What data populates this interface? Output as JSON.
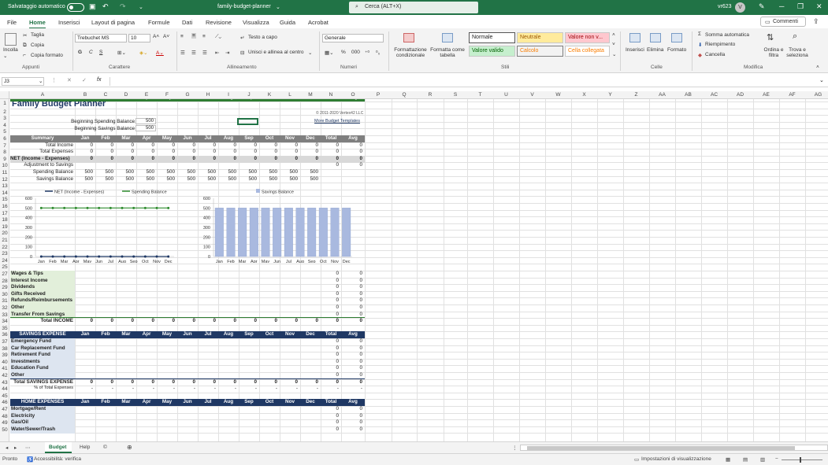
{
  "titlebar": {
    "autosave": "Salvataggio automatico",
    "filename": "family-budget-planner",
    "search": "Cerca (ALT+X)",
    "user": "vr623",
    "avatar": "V"
  },
  "tabs": [
    "File",
    "Home",
    "Inserisci",
    "Layout di pagina",
    "Formule",
    "Dati",
    "Revisione",
    "Visualizza",
    "Guida",
    "Acrobat"
  ],
  "active_tab": "Home",
  "comments": "Commenti",
  "ribbon": {
    "clipboard": {
      "paste": "Incolla",
      "cut": "Taglia",
      "copy": "Copia",
      "format_painter": "Copia formato",
      "group": "Appunti"
    },
    "font": {
      "name": "Trebuchet MS",
      "size": "10",
      "group": "Carattere"
    },
    "alignment": {
      "wrap": "Testo a capo",
      "merge": "Unisci e allinea al centro",
      "group": "Allineamento"
    },
    "number": {
      "format": "Generale",
      "group": "Numeri"
    },
    "styles": {
      "conditional": "Formattazione condizionale",
      "format_table": "Formatta come tabella",
      "normal": "Normale",
      "neutral": "Neutrale",
      "bad": "Valore non v...",
      "good": "Valore valido",
      "calc": "Calcolo",
      "linked": "Cella collegata",
      "group": "Stili"
    },
    "cells": {
      "insert": "Inserisci",
      "delete": "Elimina",
      "format": "Formato",
      "group": "Celle"
    },
    "editing": {
      "autosum": "Somma automatica",
      "fill": "Riempimento",
      "clear": "Cancella",
      "sort": "Ordina e filtra",
      "find": "Trova e seleziona",
      "group": "Modifica"
    }
  },
  "formulabar": {
    "namebox": "J3",
    "fx": "fx"
  },
  "columns": [
    "A",
    "B",
    "C",
    "D",
    "E",
    "F",
    "G",
    "H",
    "I",
    "J",
    "K",
    "L",
    "M",
    "N",
    "O",
    "P",
    "Q",
    "R",
    "S",
    "T",
    "U",
    "V",
    "W",
    "X",
    "Y",
    "Z",
    "AA",
    "AB",
    "AC",
    "AD",
    "AE",
    "AF",
    "AG"
  ],
  "sheet": {
    "title": "Family Budget Planner",
    "copyright": "© 2011-2020 Vertex42 LLC",
    "link": "More Budget Templates",
    "beg_spending_label": "Beginning Spending Balance",
    "beg_spending": "500",
    "beg_savings_label": "Beginning Savings Balance",
    "beg_savings": "500",
    "months": [
      "Jan",
      "Feb",
      "Mar",
      "Apr",
      "May",
      "Jun",
      "Jul",
      "Aug",
      "Sep",
      "Oct",
      "Nov",
      "Dec"
    ],
    "total": "Total",
    "avg": "Avg",
    "summary_label": "Summary",
    "summary_rows": [
      {
        "label": "Total Income",
        "vals": [
          "0",
          "0",
          "0",
          "0",
          "0",
          "0",
          "0",
          "0",
          "0",
          "0",
          "0",
          "0",
          "0",
          "0"
        ]
      },
      {
        "label": "Total Expenses",
        "vals": [
          "0",
          "0",
          "0",
          "0",
          "0",
          "0",
          "0",
          "0",
          "0",
          "0",
          "0",
          "0",
          "0",
          "0"
        ]
      },
      {
        "label": "NET (Income - Expenses)",
        "vals": [
          "0",
          "0",
          "0",
          "0",
          "0",
          "0",
          "0",
          "0",
          "0",
          "0",
          "0",
          "0",
          "0",
          "0"
        ]
      },
      {
        "label": "Adjustment to Savings",
        "vals": [
          "",
          "",
          "",
          "",
          "",
          "",
          "",
          "",
          "",
          "",
          "",
          "",
          "0",
          "0"
        ]
      },
      {
        "label": "Spending Balance",
        "vals": [
          "500",
          "500",
          "500",
          "500",
          "500",
          "500",
          "500",
          "500",
          "500",
          "500",
          "500",
          "500",
          "",
          ""
        ]
      },
      {
        "label": "Savings Balance",
        "vals": [
          "500",
          "500",
          "500",
          "500",
          "500",
          "500",
          "500",
          "500",
          "500",
          "500",
          "500",
          "500",
          "",
          ""
        ]
      }
    ],
    "income_label": "INCOME",
    "income_rows": [
      "Wages & Tips",
      "Interest Income",
      "Dividends",
      "Gifts Received",
      "Refunds/Reimbursements",
      "Other",
      "Transfer From Savings"
    ],
    "income_total": "Total INCOME",
    "savings_label": "SAVINGS EXPENSE",
    "savings_rows": [
      "Emergency Fund",
      "Car Replacement Fund",
      "Retirement Fund",
      "Investments",
      "Education Fund",
      "Other"
    ],
    "savings_total": "Total SAVINGS EXPENSE",
    "savings_pct": "% of Total Expenses",
    "home_label": "HOME EXPENSES",
    "home_rows": [
      "Mortgage/Rent",
      "Electricity",
      "Gas/Oil",
      "Water/Sewer/Trash"
    ],
    "zero": "0",
    "dash": "-"
  },
  "chart_data": [
    {
      "type": "line",
      "categories": [
        "Jan",
        "Feb",
        "Mar",
        "Apr",
        "May",
        "Jun",
        "Jul",
        "Aug",
        "Sep",
        "Oct",
        "Nov",
        "Dec"
      ],
      "series": [
        {
          "name": "NET (Income - Expenses)",
          "values": [
            0,
            0,
            0,
            0,
            0,
            0,
            0,
            0,
            0,
            0,
            0,
            0
          ],
          "color": "#1f3864"
        },
        {
          "name": "Spending Balance",
          "values": [
            500,
            500,
            500,
            500,
            500,
            500,
            500,
            500,
            500,
            500,
            500,
            500
          ],
          "color": "#2e8b2e"
        }
      ],
      "ylim": [
        0,
        600
      ],
      "yticks": [
        0,
        100,
        200,
        300,
        400,
        500,
        600
      ],
      "legend": "top"
    },
    {
      "type": "bar",
      "categories": [
        "Jan",
        "Feb",
        "Mar",
        "Apr",
        "May",
        "Jun",
        "Jul",
        "Aug",
        "Sep",
        "Oct",
        "Nov",
        "Dec"
      ],
      "series": [
        {
          "name": "Savings Balance",
          "values": [
            500,
            500,
            500,
            500,
            500,
            500,
            500,
            500,
            500,
            500,
            500,
            500
          ],
          "color": "#a9b9df"
        }
      ],
      "ylim": [
        0,
        600
      ],
      "yticks": [
        0,
        100,
        200,
        300,
        400,
        500,
        600
      ],
      "legend": "top"
    }
  ],
  "sheet_tabs": [
    "Budget",
    "Help",
    "©"
  ],
  "status": {
    "ready": "Pronto",
    "access": "Accessibilità: verifica",
    "display": "Impostazioni di visualizzazione"
  }
}
